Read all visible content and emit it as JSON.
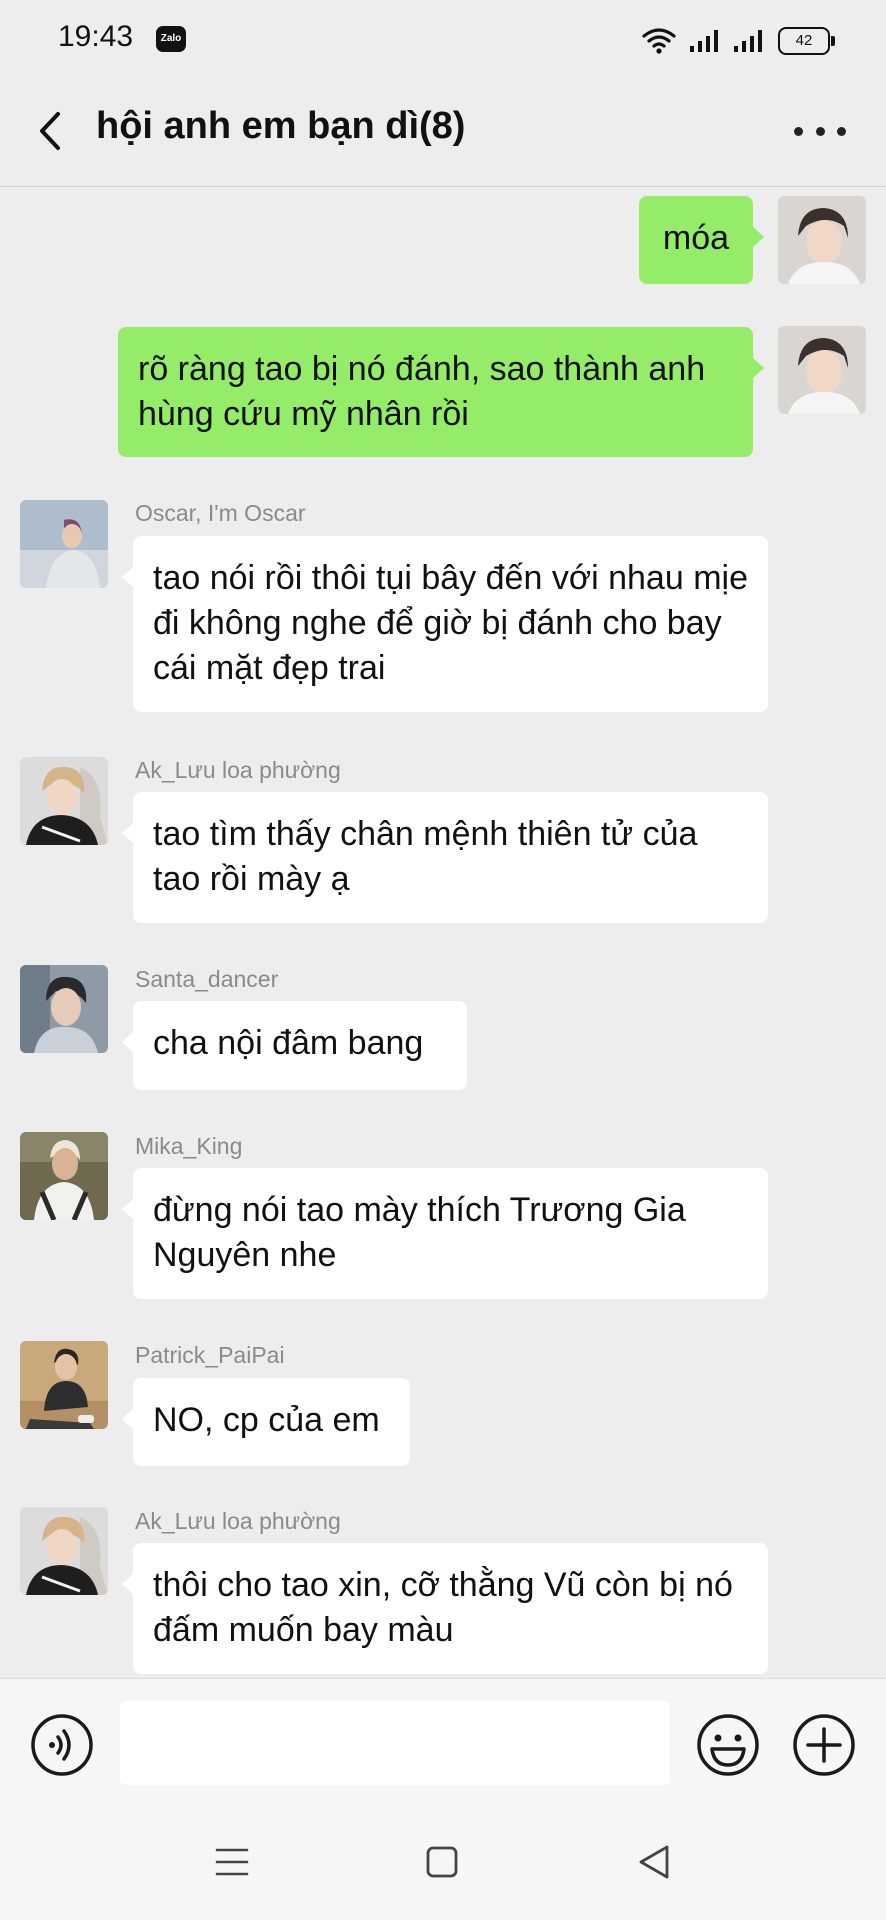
{
  "status_bar": {
    "time": "19:43",
    "app_badge": "Zalo",
    "battery": "42"
  },
  "header": {
    "title": "hội anh em bạn dì(8)"
  },
  "messages": [
    {
      "direction": "out",
      "text": "móa"
    },
    {
      "direction": "out",
      "text": "rõ ràng tao bị nó đánh, sao thành anh hùng cứu mỹ nhân rồi"
    },
    {
      "direction": "in",
      "sender": "Oscar, I'm Oscar",
      "text": "tao nói rồi thôi tụi bây đến với nhau mịe đi không nghe để giờ bị đánh cho bay cái mặt đẹp trai"
    },
    {
      "direction": "in",
      "sender": "Ak_Lưu loa phường",
      "text": "tao tìm thấy chân mệnh thiên tử của tao rồi mày ạ"
    },
    {
      "direction": "in",
      "sender": "Santa_dancer",
      "text": "cha nội đâm bang"
    },
    {
      "direction": "in",
      "sender": "Mika_King",
      "text": "đừng nói tao mày thích Trương Gia Nguyên nhe"
    },
    {
      "direction": "in",
      "sender": "Patrick_PaiPai",
      "text": "NO, cp của em"
    },
    {
      "direction": "in",
      "sender": "Ak_Lưu loa phường",
      "text": "thôi cho tao xin, cỡ thằng Vũ còn bị nó đấm muốn bay màu"
    }
  ],
  "input": {
    "value": "",
    "placeholder": ""
  },
  "colors": {
    "background": "#ededed",
    "outgoing_bubble": "#95ec69",
    "incoming_bubble": "#ffffff",
    "sender_name": "#8a8a8a"
  },
  "icons": {
    "voice": "voice-wave-icon",
    "emoji": "smiley-icon",
    "plus": "plus-circle-icon",
    "back": "chevron-left-icon",
    "more": "more-dots-icon"
  }
}
